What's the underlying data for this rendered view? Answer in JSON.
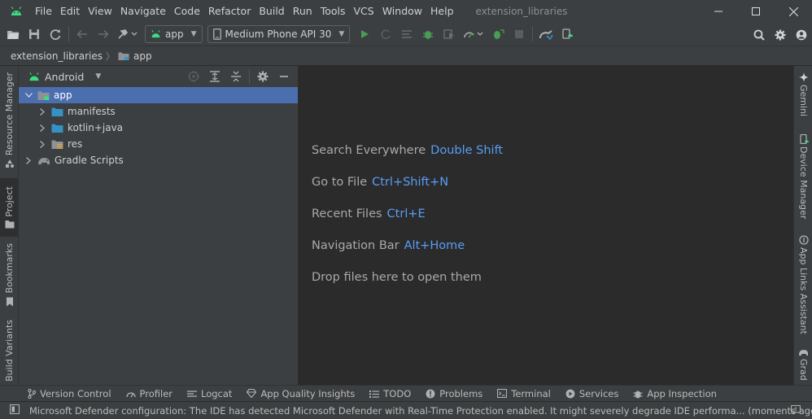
{
  "titlebar": {
    "menu": [
      "File",
      "Edit",
      "View",
      "Navigate",
      "Code",
      "Refactor",
      "Build",
      "Run",
      "Tools",
      "VCS",
      "Window",
      "Help"
    ],
    "project_name": "extension_libraries"
  },
  "toolbar": {
    "run_config": "app",
    "device": "Medium Phone API 30"
  },
  "breadcrumb": {
    "project": "extension_libraries",
    "module": "app"
  },
  "left_stripe": {
    "resource_manager": "Resource Manager",
    "project": "Project",
    "bookmarks": "Bookmarks",
    "build_variants": "Build Variants"
  },
  "right_stripe": {
    "gemini": "Gemini",
    "device_manager": "Device Manager",
    "app_links": "App Links Assistant",
    "gradle": "Grad"
  },
  "project_panel": {
    "view": "Android",
    "tree": {
      "app": "app",
      "manifests": "manifests",
      "kotlin_java": "kotlin+java",
      "res": "res",
      "gradle_scripts": "Gradle Scripts"
    }
  },
  "editor": {
    "hints": [
      {
        "label": "Search Everywhere",
        "key": "Double Shift"
      },
      {
        "label": "Go to File",
        "key": "Ctrl+Shift+N"
      },
      {
        "label": "Recent Files",
        "key": "Ctrl+E"
      },
      {
        "label": "Navigation Bar",
        "key": "Alt+Home"
      },
      {
        "label": "Drop files here to open them",
        "key": ""
      }
    ]
  },
  "bottom_tabs": [
    "Version Control",
    "Profiler",
    "Logcat",
    "App Quality Insights",
    "TODO",
    "Problems",
    "Terminal",
    "Services",
    "App Inspection"
  ],
  "status": {
    "message": "Microsoft Defender configuration: The IDE has detected Microsoft Defender with Real-Time Protection enabled. It might severely degrade IDE performa... (moments ago)"
  },
  "colors": {
    "android_green": "#3ddc84",
    "selection": "#4b6eaf",
    "shortcut_blue": "#589df6",
    "folder_blue": "#3592c4",
    "run_green": "#499c54"
  }
}
